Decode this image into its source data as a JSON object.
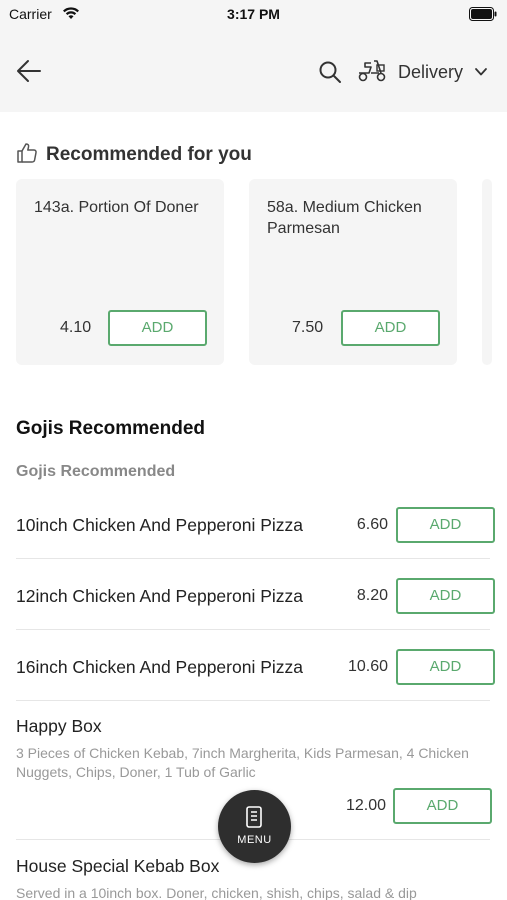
{
  "status_bar": {
    "carrier": "Carrier",
    "time": "3:17 PM"
  },
  "header": {
    "delivery_label": "Delivery",
    "icons": [
      "back-arrow-icon",
      "search-icon",
      "scooter-icon",
      "chevron-down-icon"
    ]
  },
  "recommended": {
    "title": "Recommended for you",
    "cards": [
      {
        "name": "143a. Portion Of Doner",
        "price": "4.10",
        "add_label": "ADD"
      },
      {
        "name": "58a. Medium Chicken Parmesan",
        "price": "7.50",
        "add_label": "ADD"
      }
    ]
  },
  "section": {
    "title": "Gojis Recommended",
    "subtitle": "Gojis Recommended",
    "items": [
      {
        "name": "10inch Chicken And Pepperoni Pizza",
        "price": "6.60",
        "add_label": "ADD"
      },
      {
        "name": "12inch Chicken And Pepperoni Pizza",
        "price": "8.20",
        "add_label": "ADD"
      },
      {
        "name": "16inch Chicken And Pepperoni Pizza",
        "price": "10.60",
        "add_label": "ADD"
      },
      {
        "name": "Happy Box",
        "description": "3 Pieces of Chicken Kebab, 7inch Margherita, Kids Parmesan, 4 Chicken Nuggets, Chips, Doner, 1 Tub of Garlic",
        "price": "12.00",
        "add_label": "ADD"
      },
      {
        "name": "House Special Kebab Box",
        "description": "Served in a 10inch box. Doner, chicken, shish, chips, salad & dip"
      }
    ]
  },
  "menu_button": {
    "label": "MENU"
  },
  "colors": {
    "accent": "#5aa96e",
    "header_bg": "#f5f5f5",
    "fab_bg": "#2e2e2e"
  }
}
